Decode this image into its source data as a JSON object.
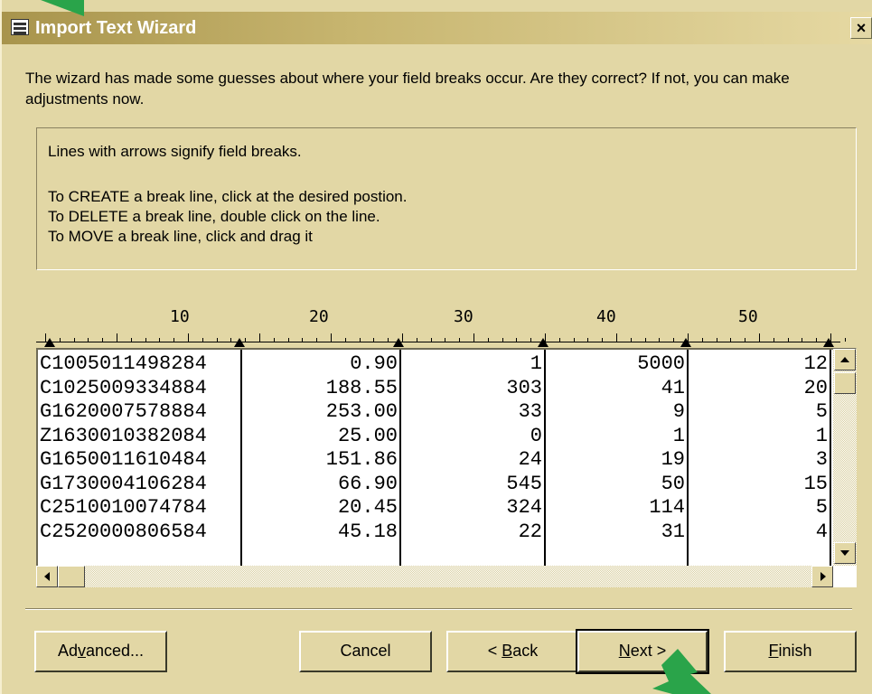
{
  "window": {
    "title": "Import Text Wizard",
    "close_label": "×"
  },
  "intro_text": "The wizard has made some guesses about where your field breaks occur.  Are they correct? If not, you can make adjustments now.",
  "info": {
    "line1": "Lines with arrows signify field breaks.",
    "line2": "To CREATE a break line, click at the desired postion.",
    "line3": "To DELETE a break line, double click on the line.",
    "line4": "To MOVE a break line, click and drag it"
  },
  "ruler": {
    "labels": [
      "10",
      "20",
      "30",
      "40",
      "50"
    ]
  },
  "preview_rows": [
    [
      "C1005011498284",
      "0.90",
      "1",
      "5000",
      "12"
    ],
    [
      "C1025009334884",
      "188.55",
      "303",
      "41",
      "20"
    ],
    [
      "G1620007578884",
      "253.00",
      "33",
      "9",
      "5"
    ],
    [
      "Z1630010382084",
      "25.00",
      "0",
      "1",
      "1"
    ],
    [
      "G1650011610484",
      "151.86",
      "24",
      "19",
      "3"
    ],
    [
      "G1730004106284",
      "66.90",
      "545",
      "50",
      "15"
    ],
    [
      "C2510010074784",
      "20.45",
      "324",
      "114",
      "5"
    ],
    [
      "C2520000806584",
      "45.18",
      "22",
      "31",
      "4"
    ]
  ],
  "buttons": {
    "advanced": {
      "pre": "Ad",
      "u": "v",
      "post": "anced..."
    },
    "cancel": "Cancel",
    "back": {
      "pre": "< ",
      "u": "B",
      "post": "ack"
    },
    "next": {
      "pre": "",
      "u": "N",
      "post": "ext >"
    },
    "finish": {
      "pre": "",
      "u": "F",
      "post": "inish"
    }
  },
  "colors": {
    "dialog_bg": "#e2d7a5",
    "slide_bg": "#8a0f0f",
    "pointer_arrow": "#2aa44a"
  }
}
